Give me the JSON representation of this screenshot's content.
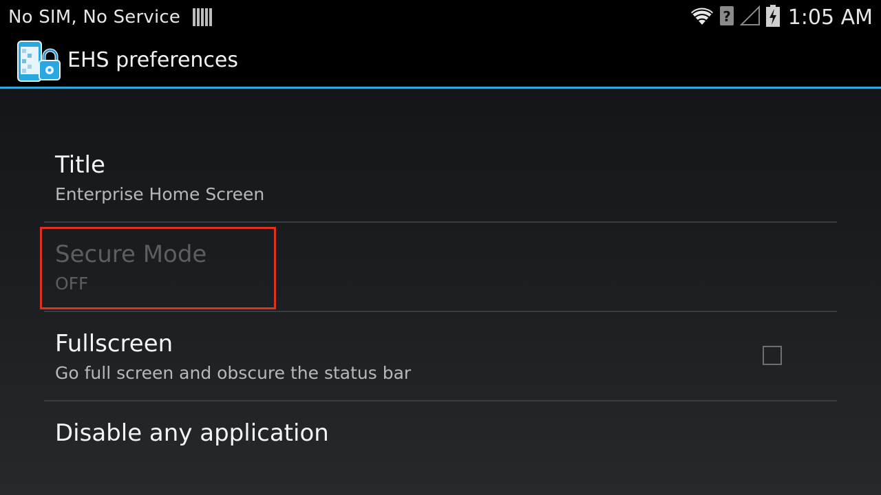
{
  "status_bar": {
    "carrier_text": "No SIM, No Service",
    "time": "1:05 AM",
    "icons": [
      "sim-card-icon",
      "wifi-icon",
      "no-sim-question-icon",
      "cell-signal-empty-icon",
      "battery-charging-icon"
    ]
  },
  "action_bar": {
    "app_icon": "ehs-lock-icon",
    "title": "EHS preferences",
    "accent_color": "#33a8da"
  },
  "preferences": [
    {
      "title": "Title",
      "summary": "Enterprise Home Screen",
      "enabled": true,
      "has_checkbox": false
    },
    {
      "title": "Secure Mode",
      "summary": "OFF",
      "enabled": false,
      "has_checkbox": false
    },
    {
      "title": "Fullscreen",
      "summary": "Go full screen and obscure the status bar",
      "enabled": true,
      "has_checkbox": true,
      "checked": false
    },
    {
      "title": "Disable any application",
      "summary": "",
      "enabled": true,
      "has_checkbox": false
    }
  ],
  "highlight_color": "#e0321a"
}
